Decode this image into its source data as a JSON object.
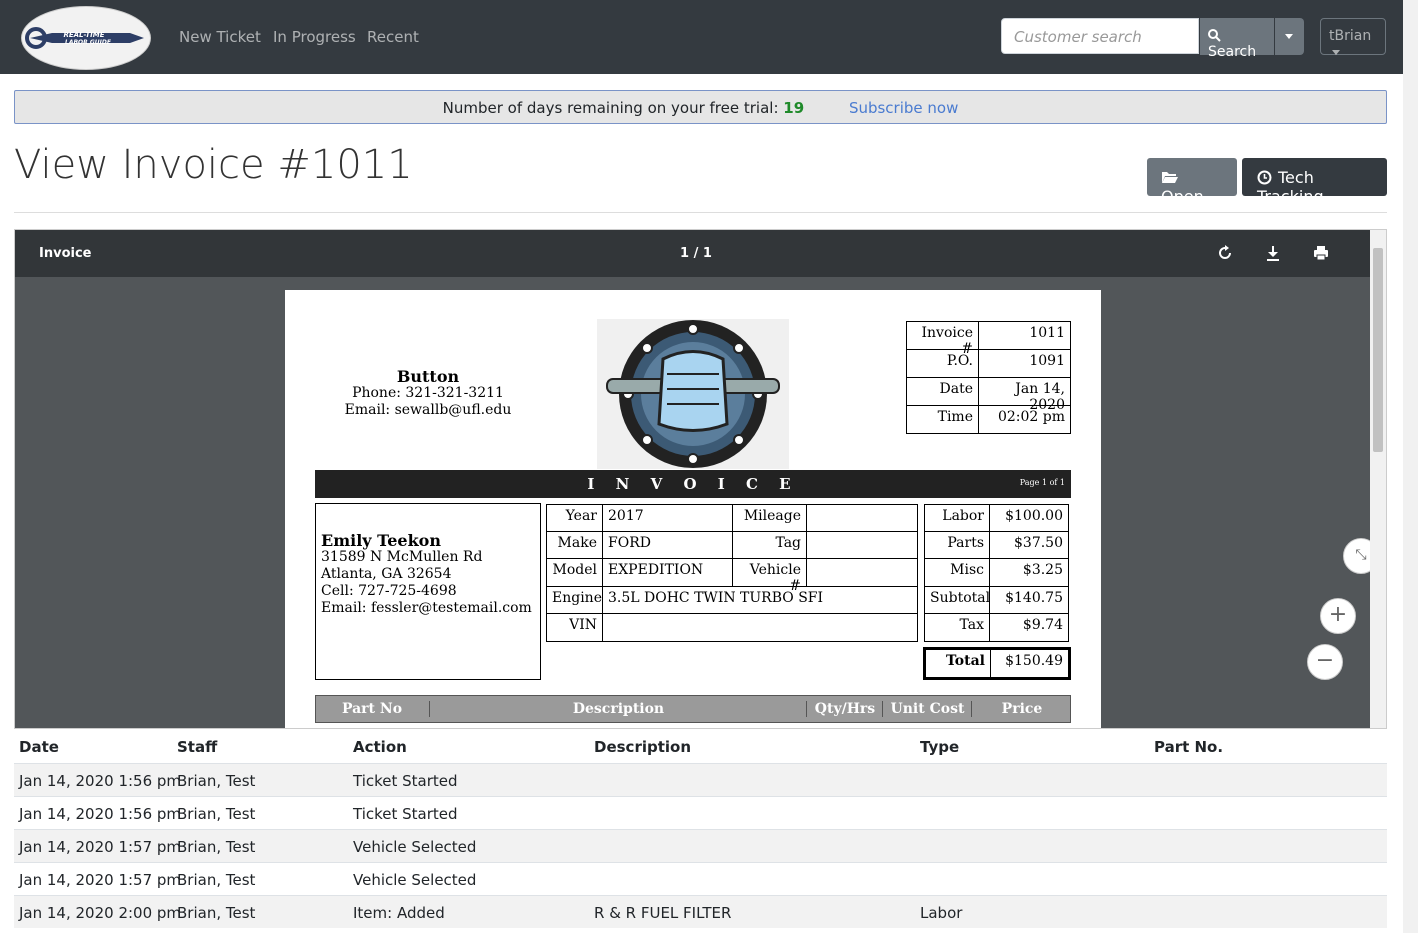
{
  "navbar": {
    "logo_text": "REAL-TIME LABOR GUIDE",
    "links": [
      "New Ticket",
      "In Progress",
      "Recent"
    ],
    "search_placeholder": "Customer search",
    "search_label": "Search",
    "user_label": "tBrian"
  },
  "trial": {
    "text": "Number of days remaining on your free trial:",
    "days": "19",
    "subscribe": "Subscribe now"
  },
  "page": {
    "title": "View Invoice #1011",
    "open_label": "Open",
    "tech_label": "Tech Tracking"
  },
  "viewer": {
    "doc_title": "Invoice",
    "page_indicator": "1 / 1"
  },
  "invoice": {
    "shop": {
      "name": "Button",
      "phone": "Phone: 321-321-3211",
      "email": "Email: sewallb@ufl.edu"
    },
    "meta": [
      {
        "label": "Invoice #",
        "value": "1011"
      },
      {
        "label": "P.O.",
        "value": "1091"
      },
      {
        "label": "Date",
        "value": "Jan 14, 2020"
      },
      {
        "label": "Time",
        "value": "02:02 pm"
      }
    ],
    "heading": "I N V O I C E",
    "page_of": "Page 1 of 1",
    "customer": {
      "name": "Emily Teekon",
      "address": "31589 N McMullen Rd",
      "city": "Atlanta, GA 32654",
      "cell": "Cell: 727-725-4698",
      "email": "Email: fessler@testemail.com"
    },
    "vehicle": {
      "year_label": "Year",
      "year": "2017",
      "mileage_label": "Mileage",
      "mileage": "",
      "make_label": "Make",
      "make": "FORD",
      "tag_label": "Tag",
      "tag": "",
      "model_label": "Model",
      "model": "EXPEDITION",
      "vehicle_no_label": "Vehicle #",
      "vehicle_no": "",
      "engine_label": "Engine",
      "engine": "3.5L DOHC TWIN TURBO SFI",
      "vin_label": "VIN",
      "vin": ""
    },
    "totals": [
      {
        "label": "Labor",
        "value": "$100.00"
      },
      {
        "label": "Parts",
        "value": "$37.50"
      },
      {
        "label": "Misc",
        "value": "$3.25"
      },
      {
        "label": "Subtotal",
        "value": "$140.75"
      },
      {
        "label": "Tax",
        "value": "$9.74"
      }
    ],
    "total": {
      "label": "Total",
      "value": "$150.49"
    },
    "columns": [
      "Part No",
      "Description",
      "Qty/Hrs",
      "Unit Cost",
      "Price"
    ]
  },
  "history": {
    "headers": [
      "Date",
      "Staff",
      "Action",
      "Description",
      "Type",
      "Part No."
    ],
    "rows": [
      [
        "Jan 14, 2020 1:56 pm",
        "Brian, Test",
        "Ticket Started",
        "",
        "",
        ""
      ],
      [
        "Jan 14, 2020 1:56 pm",
        "Brian, Test",
        "Ticket Started",
        "",
        "",
        ""
      ],
      [
        "Jan 14, 2020 1:57 pm",
        "Brian, Test",
        "Vehicle Selected",
        "",
        "",
        ""
      ],
      [
        "Jan 14, 2020 1:57 pm",
        "Brian, Test",
        "Vehicle Selected",
        "",
        "",
        ""
      ],
      [
        "Jan 14, 2020 2:00 pm",
        "Brian, Test",
        "Item: Added",
        "R & R FUEL FILTER",
        "Labor",
        ""
      ]
    ]
  },
  "colors": {
    "navbar": "#343a40",
    "trial_days": "#1f8a2a",
    "link": "#4a7bd0"
  }
}
